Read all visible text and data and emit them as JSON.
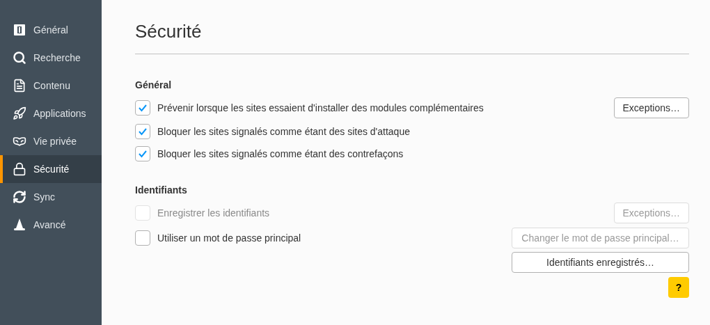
{
  "sidebar": {
    "items": [
      {
        "label": "Général",
        "selected": false
      },
      {
        "label": "Recherche",
        "selected": false
      },
      {
        "label": "Contenu",
        "selected": false
      },
      {
        "label": "Applications",
        "selected": false
      },
      {
        "label": "Vie privée",
        "selected": false
      },
      {
        "label": "Sécurité",
        "selected": true
      },
      {
        "label": "Sync",
        "selected": false
      },
      {
        "label": "Avancé",
        "selected": false
      }
    ]
  },
  "page": {
    "title": "Sécurité",
    "sections": [
      {
        "heading": "Général",
        "rows": [
          {
            "label": "Prévenir lorsque les sites essaient d'installer des modules complémentaires",
            "checked": true,
            "disabled": false,
            "button": {
              "label": "Exceptions…",
              "disabled": false
            }
          },
          {
            "label": "Bloquer les sites signalés comme étant des sites d'attaque",
            "checked": true,
            "disabled": false
          },
          {
            "label": "Bloquer les sites signalés comme étant des contrefaçons",
            "checked": true,
            "disabled": false
          }
        ]
      },
      {
        "heading": "Identifiants",
        "rows": [
          {
            "label": "Enregistrer les identifiants",
            "checked": false,
            "disabled": true,
            "button": {
              "label": "Exceptions…",
              "disabled": true
            }
          },
          {
            "label": "Utiliser un mot de passe principal",
            "checked": false,
            "disabled": false,
            "button": {
              "label": "Changer le mot de passe principal…",
              "disabled": true
            }
          }
        ],
        "buttons": [
          {
            "label": "Identifiants enregistrés…",
            "disabled": false
          }
        ]
      }
    ],
    "help": "?"
  }
}
